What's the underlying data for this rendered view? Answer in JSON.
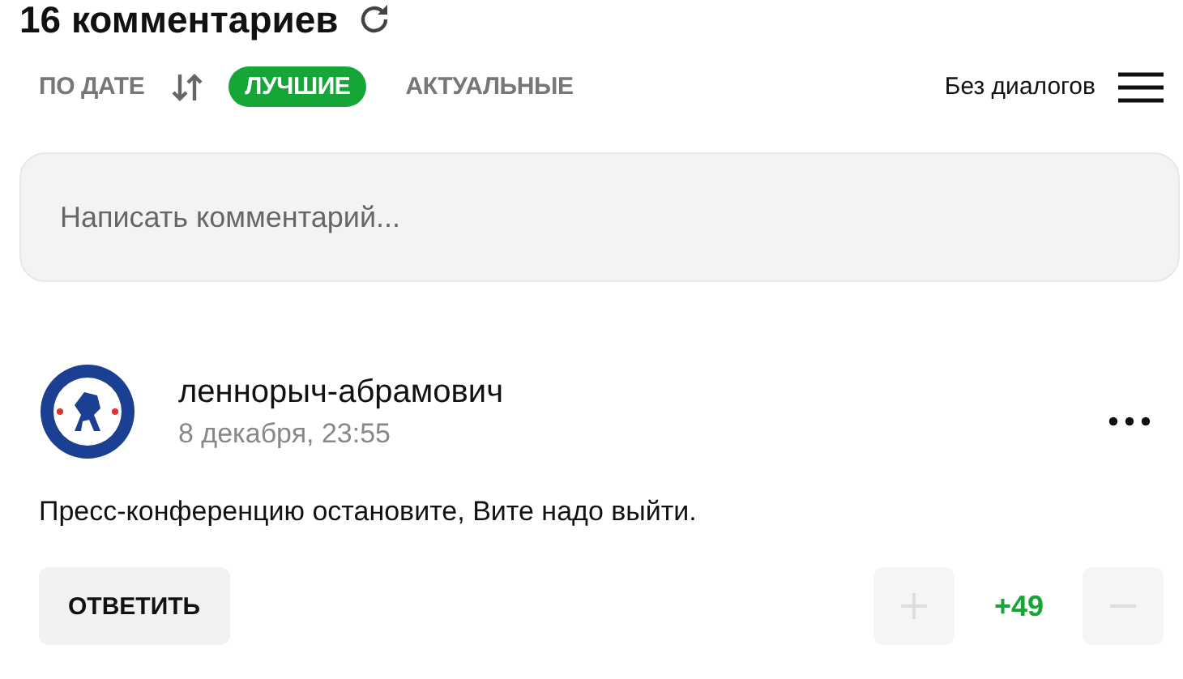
{
  "header": {
    "title": "16 комментариев"
  },
  "sort_tabs": [
    {
      "label": "ПО ДАТЕ",
      "selected": false,
      "kind": "sortable"
    },
    {
      "label": "ЛУЧШИЕ",
      "selected": true,
      "kind": "plain"
    },
    {
      "label": "АКТУАЛЬНЫЕ",
      "selected": false,
      "kind": "plain"
    }
  ],
  "filter": {
    "label": "Без диалогов"
  },
  "comment_field": {
    "placeholder": "Написать комментарий..."
  },
  "comments": [
    {
      "author": "леннорыч-абрамович",
      "time": "8 декабря, 23:55",
      "text": "Пресс-конференцию остановите, Вите надо выйти.",
      "reply": "ОТВЕТИТЬ",
      "score": "+49"
    }
  ]
}
